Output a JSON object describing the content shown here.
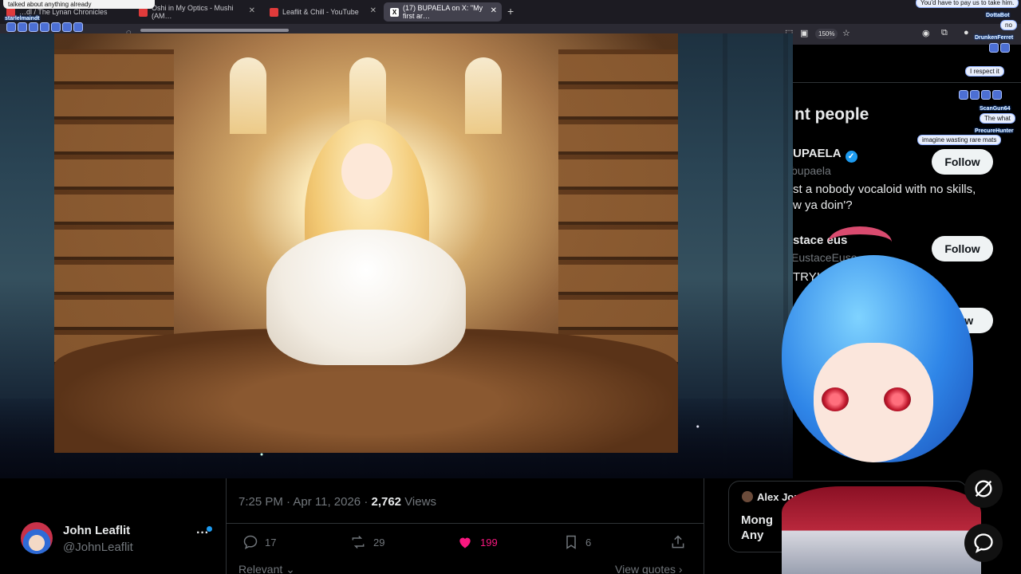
{
  "browser": {
    "tabs": [
      {
        "label": "…dl / The Lynan Chronicles",
        "active": false,
        "favicon_color": "#e03b3b"
      },
      {
        "label": "Oshi in My Optics - Mushi (AM…",
        "active": false,
        "favicon_color": "#e03b3b"
      },
      {
        "label": "Leaflit & Chill - YouTube",
        "active": false,
        "favicon_color": "#e03b3b"
      },
      {
        "label": "(17) BUPAELA on X: \"My first ar…",
        "active": true,
        "favicon_color": "#ffffff"
      }
    ],
    "new_tab_symbol": "+",
    "close_symbol": "✕",
    "zoom": "150%"
  },
  "stream_overlay": {
    "top_note": "talked about anything already",
    "chat": [
      {
        "user": "DottaBot",
        "message": "no"
      },
      {
        "user": "DrunkenFerret",
        "message": ""
      },
      {
        "user": "",
        "message": "I respect it"
      },
      {
        "user": "ScanGun64",
        "message": "The what"
      },
      {
        "user": "PrecureHunter",
        "message": "imagine wasting rare mats"
      },
      {
        "user": "",
        "message": "You'd have to pay us to take him."
      }
    ],
    "chat_user_left": "starlelmaindt"
  },
  "relevant_people": {
    "heading": "nt people",
    "people": [
      {
        "name": "UPAELA",
        "handle": "bupaela",
        "bio_line1": "st a nobody vocaloid with no skills,",
        "bio_line2": "w ya doin'?",
        "follow": "Follow",
        "verified": true
      },
      {
        "name": "stace eus",
        "handle": "EustaceEuse",
        "bio_line1": "TRY!          ?!Y I CAN",
        "bio_line2": "",
        "follow": "Follow",
        "verified": false
      },
      {
        "name": "",
        "handle": "",
        "bio_line1": "",
        "bio_line2": "",
        "follow": "llow",
        "verified": false
      }
    ]
  },
  "tweet": {
    "time": "7:25 PM · Apr 11, 2026 · ",
    "views_count": "2,762",
    "views_label": " Views",
    "replies": "17",
    "reposts": "29",
    "likes": "199",
    "bookmarks": "6",
    "sort_label": "Relevant",
    "view_quotes": "View quotes"
  },
  "account": {
    "name": "John Leaflit",
    "handle": "@JohnLeaflit",
    "more": "···"
  },
  "trend": {
    "author": "Alex Jones",
    "line1": "Mong",
    "line2": "Any"
  },
  "colors": {
    "like": "#f91880",
    "accent": "#1d9bf0",
    "muted": "#71767b"
  }
}
